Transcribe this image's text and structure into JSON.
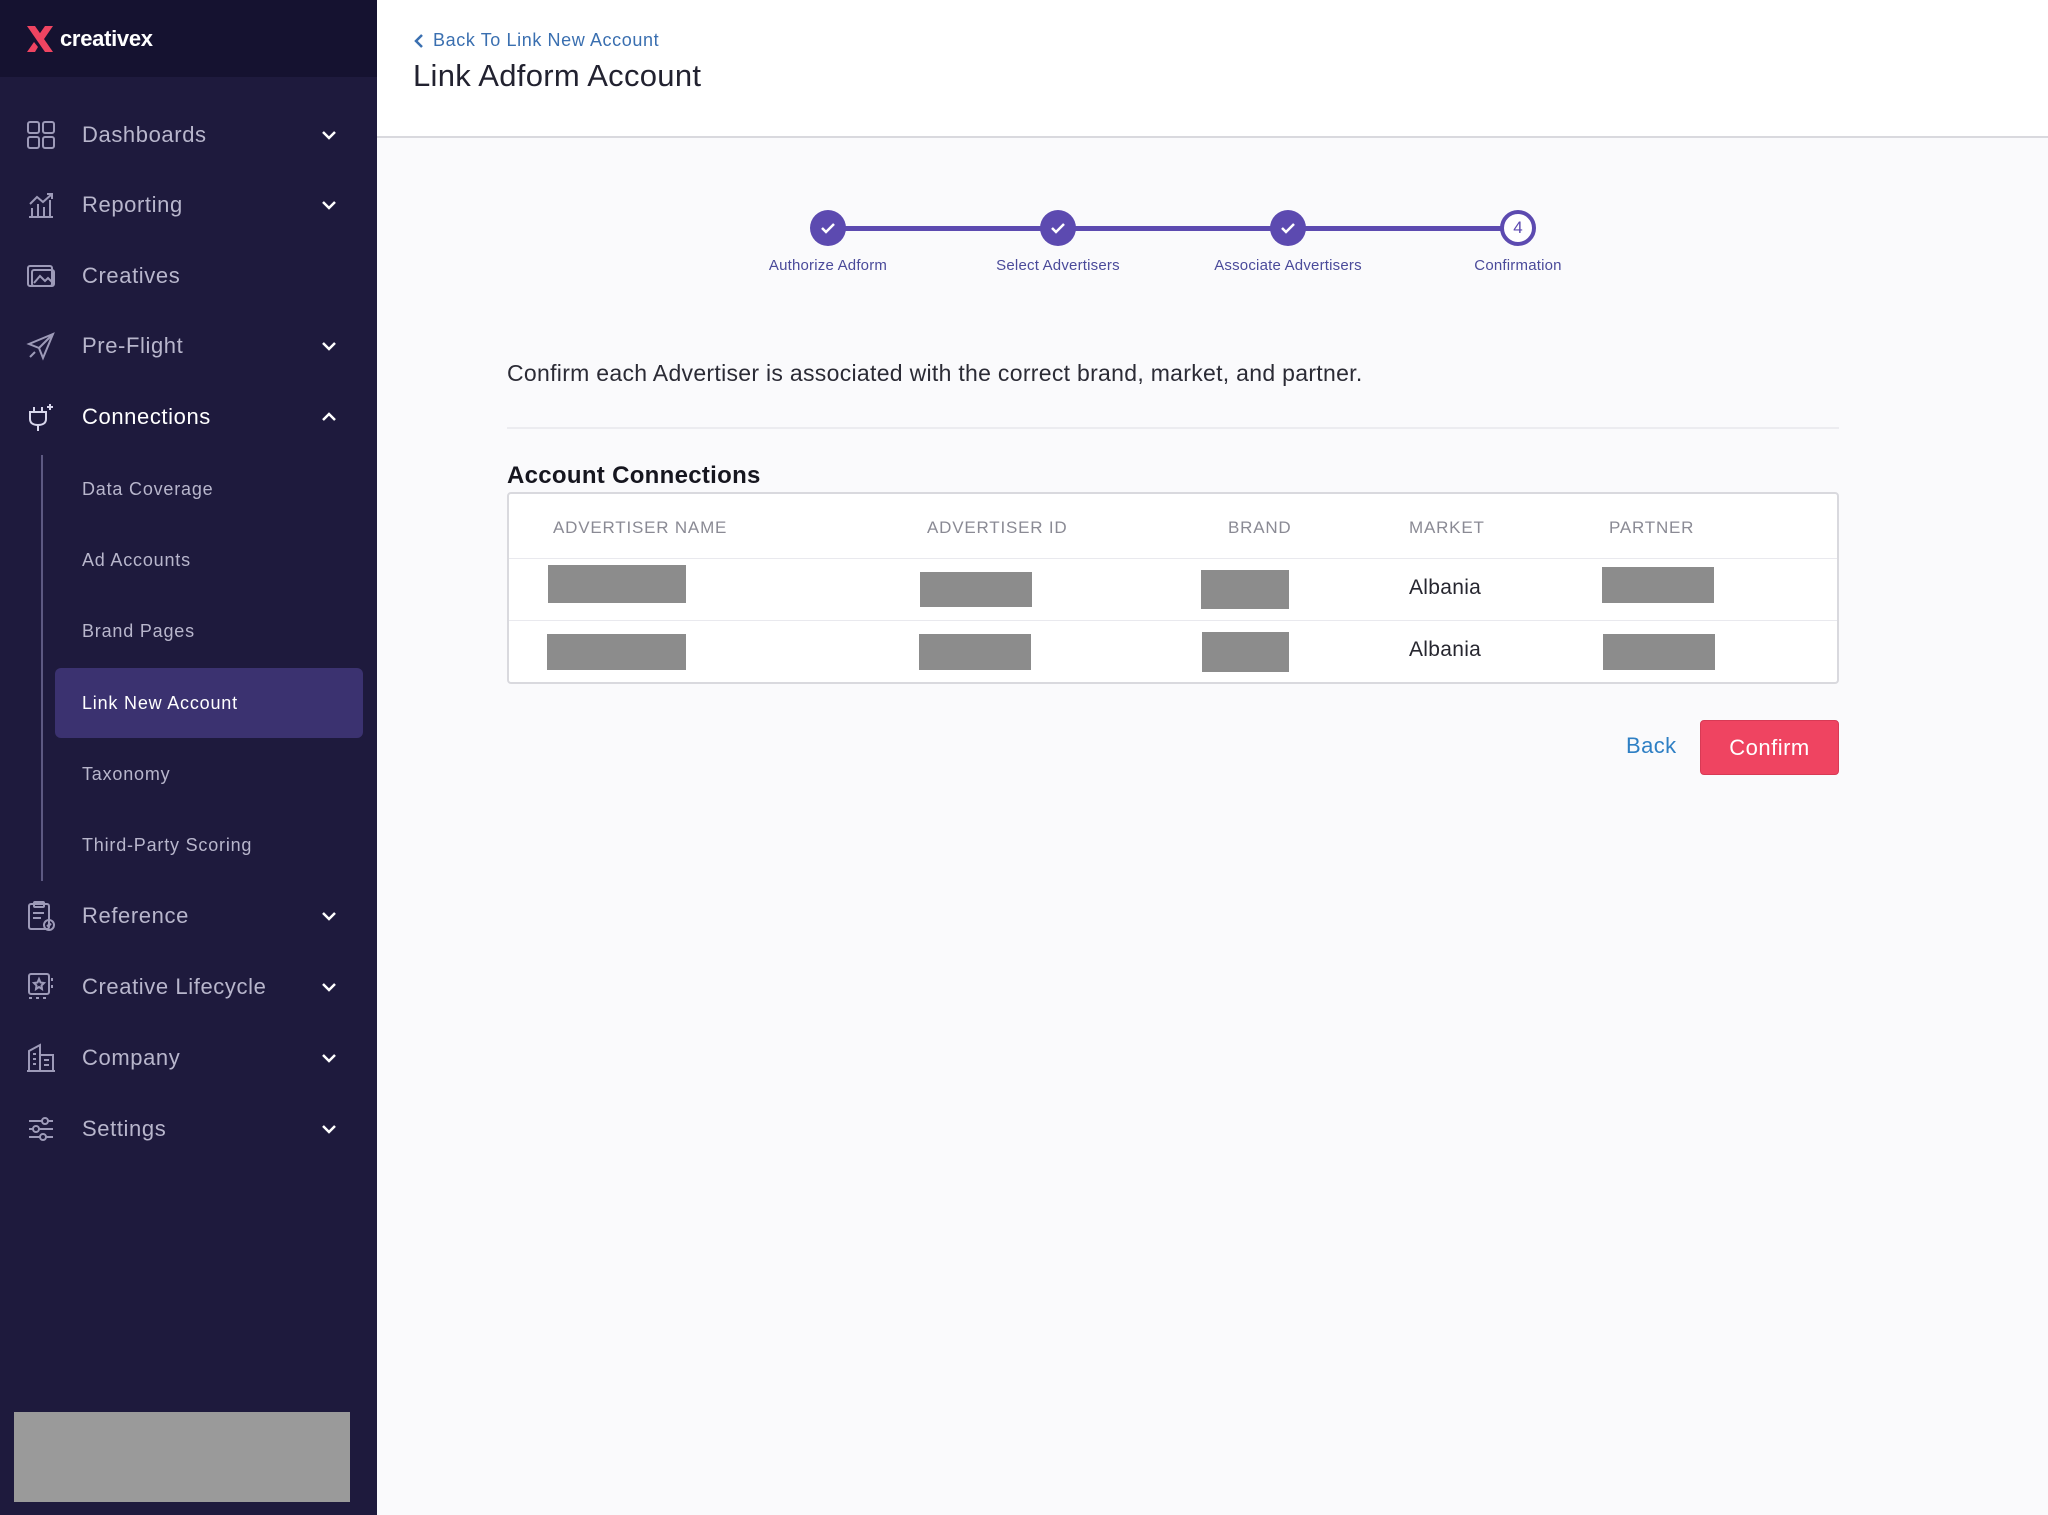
{
  "brand": {
    "name": "creativex",
    "accent": "#ef4461",
    "sidebar_bg": "#1e1a3d",
    "step_color": "#5c4ab0"
  },
  "sidebar": {
    "items": [
      {
        "label": "Dashboards",
        "icon": "dashboard-grid-icon",
        "expandable": true,
        "open": false
      },
      {
        "label": "Reporting",
        "icon": "chart-trend-icon",
        "expandable": true,
        "open": false
      },
      {
        "label": "Creatives",
        "icon": "creatives-icon",
        "expandable": false,
        "open": false
      },
      {
        "label": "Pre-Flight",
        "icon": "paper-plane-icon",
        "expandable": true,
        "open": false
      },
      {
        "label": "Connections",
        "icon": "plug-icon",
        "expandable": true,
        "open": true
      },
      {
        "label": "Reference",
        "icon": "clipboard-check-icon",
        "expandable": true,
        "open": false
      },
      {
        "label": "Creative Lifecycle",
        "icon": "lifecycle-icon",
        "expandable": true,
        "open": false
      },
      {
        "label": "Company",
        "icon": "building-icon",
        "expandable": true,
        "open": false
      },
      {
        "label": "Settings",
        "icon": "sliders-icon",
        "expandable": true,
        "open": false
      }
    ],
    "connections_sub": [
      {
        "label": "Data Coverage",
        "active": false
      },
      {
        "label": "Ad Accounts",
        "active": false
      },
      {
        "label": "Brand Pages",
        "active": false
      },
      {
        "label": "Link New Account",
        "active": true
      },
      {
        "label": "Taxonomy",
        "active": false
      },
      {
        "label": "Third-Party Scoring",
        "active": false
      }
    ]
  },
  "header": {
    "back_label": "Back To Link New Account",
    "title": "Link Adform Account"
  },
  "stepper": {
    "steps": [
      {
        "label": "Authorize Adform",
        "state": "done"
      },
      {
        "label": "Select Advertisers",
        "state": "done"
      },
      {
        "label": "Associate Advertisers",
        "state": "done"
      },
      {
        "label": "Confirmation",
        "state": "current",
        "number": "4"
      }
    ]
  },
  "main": {
    "instruction": "Confirm each Advertiser is associated with the correct brand, market, and partner.",
    "section_title": "Account Connections",
    "table": {
      "columns": [
        "ADVERTISER NAME",
        "ADVERTISER ID",
        "BRAND",
        "MARKET",
        "PARTNER"
      ],
      "rows": [
        {
          "market": "Albania"
        },
        {
          "market": "Albania"
        }
      ]
    },
    "back_button": "Back",
    "confirm_button": "Confirm"
  }
}
